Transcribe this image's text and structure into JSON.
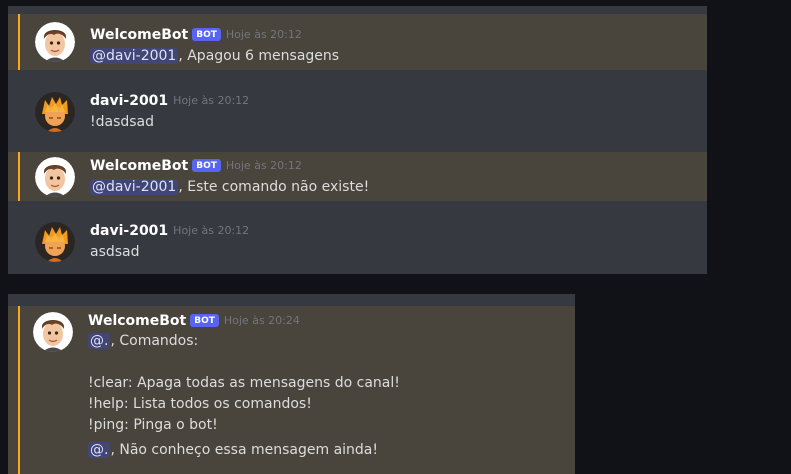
{
  "colors": {
    "page_bg": "#111217",
    "panel_bg": "#36393f",
    "mention_bg": "#49443c",
    "mention_bar": "#faa81a",
    "bot_tag": "#5865f2",
    "mention_chip": "#414675"
  },
  "messages_top": [
    {
      "author": "WelcomeBot",
      "bot_tag": "BOT",
      "timestamp": "Hoje às 20:12",
      "mention": "@davi-2001",
      "text": ", Apagou 6 mensagens",
      "avatar_icon": "memoji-avatar-icon"
    },
    {
      "author": "davi-2001",
      "timestamp": "Hoje às 20:12",
      "text": "!dasdsad",
      "avatar_icon": "anime-avatar-icon"
    },
    {
      "author": "WelcomeBot",
      "bot_tag": "BOT",
      "timestamp": "Hoje às 20:12",
      "mention": "@davi-2001",
      "text": ", Este comando não existe!",
      "avatar_icon": "memoji-avatar-icon"
    },
    {
      "author": "davi-2001",
      "timestamp": "Hoje às 20:12",
      "text": "asdsad",
      "avatar_icon": "anime-avatar-icon"
    }
  ],
  "message_bottom": {
    "author": "WelcomeBot",
    "bot_tag": "BOT",
    "timestamp": "Hoje às 20:24",
    "mention": "@.",
    "intro": ", Comandos:",
    "commands": [
      "!clear: Apaga todas as mensagens do canal!",
      "!help: Lista todos os comandos!",
      "!ping: Pinga o bot!"
    ],
    "mention2": "@.",
    "outro": ", Não conheço essa mensagem ainda!",
    "avatar_icon": "memoji-avatar-icon"
  }
}
